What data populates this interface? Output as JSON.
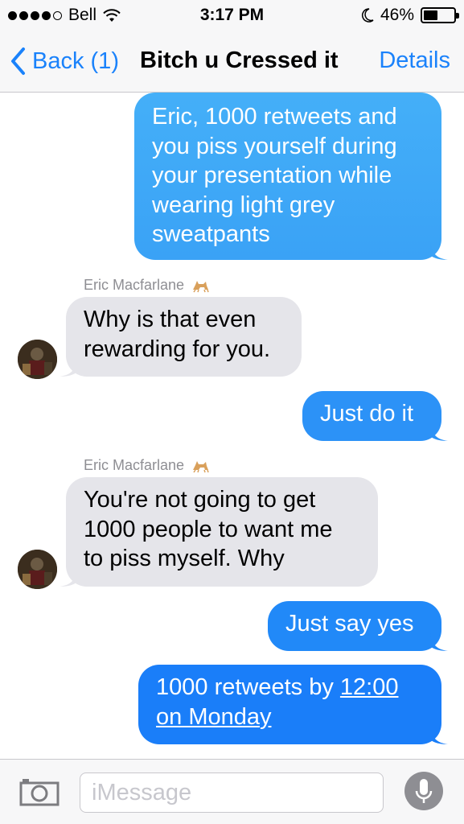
{
  "status_bar": {
    "carrier": "Bell",
    "time": "3:17 PM",
    "battery": "46%",
    "battery_level": 0.46,
    "signal_filled": 4,
    "signal_total": 5
  },
  "nav": {
    "back_label": "Back (1)",
    "title": "Bitch u Cressed it",
    "details_label": "Details"
  },
  "messages": [
    {
      "direction": "sent",
      "text_lines": [
        "Eric, 1000 retweets and",
        "you piss yourself during",
        "your presentation while",
        "wearing light grey",
        "sweatpants"
      ]
    },
    {
      "direction": "received",
      "sender": "Eric Macfarlane",
      "text_lines": [
        "Why is that even",
        "rewarding for you."
      ]
    },
    {
      "direction": "sent",
      "text_lines": [
        "Just do it"
      ]
    },
    {
      "direction": "received",
      "sender": "Eric Macfarlane",
      "text_lines": [
        "You're not going to get",
        "1000 people to want me",
        "to piss myself. Why"
      ]
    },
    {
      "direction": "sent",
      "text_lines": [
        "Just say yes"
      ]
    },
    {
      "direction": "sent",
      "line1": "1000 retweets by ",
      "link1": "12:00",
      "link2": "on Monday"
    }
  ],
  "input": {
    "placeholder": "iMessage"
  },
  "icons": {
    "back": "chevron-left-icon",
    "camera": "camera-icon",
    "microphone": "microphone-icon",
    "sender_emoji": "cat-icon",
    "wifi": "wifi-icon",
    "moon": "moon-icon"
  },
  "colors": {
    "accent": "#1a82fb",
    "sent_bubble_light": "#3ba3f7",
    "sent_bubble_dark": "#1a82fb",
    "received_bubble": "#e5e5ea",
    "bar_background": "#f7f7f8"
  }
}
